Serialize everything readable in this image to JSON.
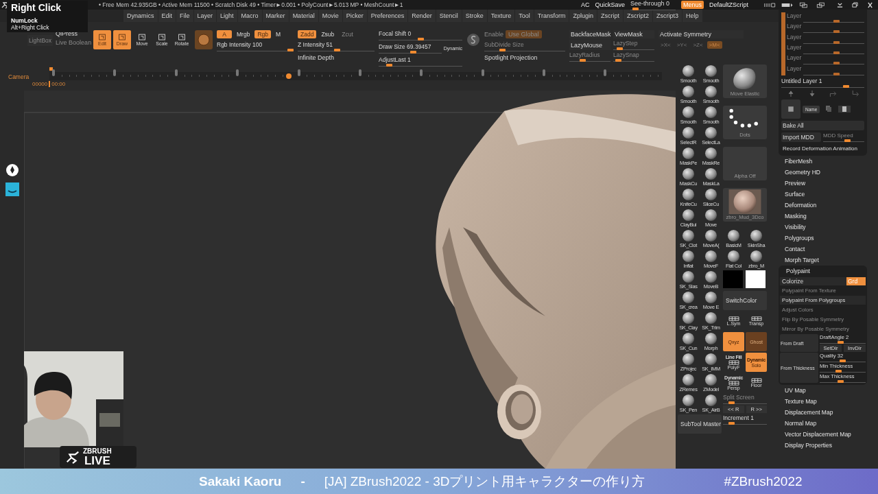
{
  "tooltip": {
    "title": "Right Click",
    "lines": [
      "NumLock",
      "Alt+Right Click"
    ]
  },
  "status_bar": {
    "info": "• Free Mem 42.935GB • Active Mem 11500 • Scratch Disk 49 •  Timer►0.001 • PolyCount►5.013 MP  • MeshCount►1",
    "items": [
      "AC",
      "QuickSave"
    ],
    "see_through": {
      "label": "See-through  0",
      "level": 0.05
    },
    "menus": {
      "label": "Menus",
      "on": true
    },
    "script": "DefaultZScript"
  },
  "menu": [
    "Dynamics",
    "Edit",
    "File",
    "Layer",
    "Light",
    "Macro",
    "Marker",
    "Material",
    "Movie",
    "Picker",
    "Preferences",
    "Render",
    "Stencil",
    "Stroke",
    "Texture",
    "Tool",
    "Transform",
    "Zplugin",
    "Zscript",
    "Zscript2",
    "Zscript3",
    "Help"
  ],
  "shelf": {
    "lightbox": {
      "label": "LightBox",
      "disabled": true
    },
    "live_boolean": {
      "label": "Live Boolean",
      "disabled": true
    },
    "qipress": "QiPress",
    "modes": [
      {
        "label": "Edit",
        "selected": true
      },
      {
        "label": "Draw",
        "selected": true
      },
      {
        "label": "Move",
        "selected": false
      },
      {
        "label": "Scale",
        "selected": false
      },
      {
        "label": "Rotate",
        "selected": false
      }
    ],
    "color_toggles": [
      {
        "label": "A",
        "on": true
      },
      {
        "label": "Mrgb",
        "on": false
      },
      {
        "label": "Rgb",
        "on": true
      },
      {
        "label": "M",
        "on": false
      }
    ],
    "rgb_intensity": {
      "label": "Rgb Intensity 100",
      "level": 1.0
    },
    "z_toggles": [
      {
        "label": "Zadd",
        "on": true,
        "disabled": false
      },
      {
        "label": "Zsub",
        "on": false,
        "disabled": false
      },
      {
        "label": "Zcut",
        "on": false,
        "disabled": true
      }
    ],
    "z_intensity": {
      "label": "Z Intensity 51",
      "level": 0.51
    },
    "infinite_depth": "Infinite Depth",
    "focal_shift": {
      "label": "Focal Shift 0",
      "level": 0.5
    },
    "draw_size": {
      "label": "Draw Size 69.39457",
      "level": 0.55
    },
    "dynamic": "Dynamic",
    "adjust_last": {
      "label": "AdjustLast 1",
      "level": 0.1
    },
    "enable": {
      "label": "Enable",
      "disabled": true
    },
    "use_global": {
      "label": "Use Global",
      "disabled": true
    },
    "subdivide": {
      "label": "SubDivide Size",
      "level": 0.2,
      "disabled": true
    },
    "spotlight": "Spotlight Projection",
    "backface_mask": "BackfaceMask",
    "view_mask": "ViewMask",
    "lazy_mouse": "LazyMouse",
    "lazy_step": {
      "label": "LazyStep",
      "level": 0.1,
      "disabled": true
    },
    "lazy_radius": {
      "label": "LazyRadius",
      "level": 0.3,
      "disabled": true
    },
    "lazy_snap": {
      "label": "LazySnap",
      "level": 0.05,
      "disabled": true
    },
    "activate_symmetry": "Activate Symmetry",
    "axes": [
      {
        "label": ">X<",
        "on": false
      },
      {
        "label": ">Y<",
        "on": false
      },
      {
        "label": ">Z<",
        "on": false
      },
      {
        "label": ">M<",
        "on": true
      }
    ]
  },
  "timeline": {
    "label": "Camera",
    "frame": "00000",
    "time": "00:00",
    "level": 0.39
  },
  "banner": {
    "name": "Sakaki Kaoru",
    "separator": "-",
    "title": "[JA] ZBrush2022 - 3Dプリント用キャラクターの作り方",
    "hashtag": "#ZBrush2022"
  },
  "logo": {
    "top": "ZBRUSH",
    "bottom": "LIVE"
  },
  "brush_palette": [
    {
      "kind": "brush",
      "label": "Smooth"
    },
    {
      "kind": "brush",
      "label": "Smooth"
    },
    {
      "kind": "brush_large",
      "label": "Move Elastic"
    },
    {
      "kind": "brush",
      "label": "Smooth"
    },
    {
      "kind": "brush",
      "label": "Smooth"
    },
    {
      "kind": "brush",
      "label": "Smooth"
    },
    {
      "kind": "brush",
      "label": "Smooth"
    },
    {
      "kind": "stroke",
      "label": "Dots"
    },
    {
      "kind": "brush",
      "label": "SelectR"
    },
    {
      "kind": "brush",
      "label": "SelectLa"
    },
    {
      "kind": "brush",
      "label": "MaskPe"
    },
    {
      "kind": "brush",
      "label": "MaskRe"
    },
    {
      "kind": "alpha",
      "label": "Alpha Off"
    },
    {
      "kind": "brush",
      "label": "MaskCu"
    },
    {
      "kind": "brush",
      "label": "MaskLa"
    },
    {
      "kind": "brush",
      "label": "KnifeCu"
    },
    {
      "kind": "brush",
      "label": "SliceCu"
    },
    {
      "kind": "material",
      "label": "zbro_Mud_3Dco"
    },
    {
      "kind": "brush",
      "label": "ClayBui"
    },
    {
      "kind": "brush",
      "label": "Move"
    },
    {
      "kind": "brush",
      "label": "SK_Clot"
    },
    {
      "kind": "brush",
      "label": "MoveA("
    },
    {
      "kind": "brush",
      "label": "BasicM"
    },
    {
      "kind": "brush",
      "label": "SkinSha"
    },
    {
      "kind": "brush",
      "label": "Inflat"
    },
    {
      "kind": "brush",
      "label": "MoveF"
    },
    {
      "kind": "brush",
      "label": "Flat Col"
    },
    {
      "kind": "brush",
      "label": "zbro_M"
    },
    {
      "kind": "brush",
      "label": "SK_Slas"
    },
    {
      "kind": "brush",
      "label": "MoveB"
    },
    {
      "kind": "swatch",
      "color": "#000000"
    },
    {
      "kind": "swatch",
      "color": "#ffffff"
    },
    {
      "kind": "brush",
      "label": "SK_crea"
    },
    {
      "kind": "brush",
      "label": "Move E"
    },
    {
      "kind": "wide",
      "label": "SwitchColor"
    },
    {
      "kind": "brush",
      "label": "SK_Clay"
    },
    {
      "kind": "brush",
      "label": "SK_Trim"
    },
    {
      "kind": "tool",
      "label": "L.Sym"
    },
    {
      "kind": "tool",
      "label": "Transp"
    },
    {
      "kind": "brush",
      "label": "SK_Cun"
    },
    {
      "kind": "brush",
      "label": "Morph"
    },
    {
      "kind": "toggle",
      "label": "Qxyz",
      "selected": true
    },
    {
      "kind": "toggle",
      "label": "Ghost",
      "selected": false
    },
    {
      "kind": "brush",
      "label": "ZProjec"
    },
    {
      "kind": "brush",
      "label": "SK_IMM"
    },
    {
      "kind": "tool",
      "label": "PolyF",
      "sub": "Line Fill"
    },
    {
      "kind": "toggle",
      "label": "Solo",
      "sub": "Dynamic",
      "selected": true
    },
    {
      "kind": "brush",
      "label": "ZRemes"
    },
    {
      "kind": "brush",
      "label": "ZModel"
    },
    {
      "kind": "tool",
      "label": "Persp",
      "sub": "Dynamic"
    },
    {
      "kind": "tool",
      "label": "Floor"
    },
    {
      "kind": "brush",
      "label": "SK_Pen"
    },
    {
      "kind": "brush",
      "label": "SK_AirB"
    },
    {
      "kind": "split",
      "label": "Split Screen",
      "level": 0.15,
      "buttons": [
        "<< R",
        "R >>"
      ]
    },
    {
      "kind": "wide",
      "label": "SubTool Master"
    },
    {
      "kind": "slider",
      "label": "Increment 1",
      "level": 0.15
    }
  ],
  "layers": {
    "items": [
      {
        "label": "Layer",
        "level": 0.55
      },
      {
        "label": "Layer",
        "level": 0.55
      },
      {
        "label": "Layer",
        "level": 0.55
      },
      {
        "label": "Layer",
        "level": 0.55
      },
      {
        "label": "Layer",
        "level": 0.55
      },
      {
        "label": "Layer",
        "level": 0.55
      }
    ],
    "current": {
      "label": "Untitled Layer 1",
      "level": 0.8
    },
    "name_button": "Name",
    "bake_all": "Bake All",
    "import_mdd": "Import MDD",
    "mdd_speed": {
      "label": "MDD Speed",
      "level": 0.6,
      "disabled": true
    },
    "record": "Record Deformation Animation"
  },
  "subpalettes": [
    {
      "label": "FiberMesh",
      "expanded": false
    },
    {
      "label": "Geometry HD",
      "expanded": false
    },
    {
      "label": "Preview",
      "expanded": false
    },
    {
      "label": "Surface",
      "expanded": false
    },
    {
      "label": "Deformation",
      "expanded": false
    },
    {
      "label": "Masking",
      "expanded": false
    },
    {
      "label": "Visibility",
      "expanded": false
    },
    {
      "label": "Polygroups",
      "expanded": false
    },
    {
      "label": "Contact",
      "expanded": false
    },
    {
      "label": "Morph Target",
      "expanded": false
    },
    {
      "label": "Polypaint",
      "expanded": true
    },
    {
      "label": "UV Map",
      "expanded": false
    },
    {
      "label": "Texture Map",
      "expanded": false
    },
    {
      "label": "Displacement Map",
      "expanded": false
    },
    {
      "label": "Normal Map",
      "expanded": false
    },
    {
      "label": "Vector Displacement Map",
      "expanded": false
    },
    {
      "label": "Display Properties",
      "expanded": false
    }
  ],
  "polypaint": {
    "colorize": "Colorize",
    "grd": {
      "label": "Grd",
      "on": true
    },
    "buttons": [
      {
        "label": "Polypaint From Texture",
        "disabled": true
      },
      {
        "label": "Polypaint From Polygroups",
        "disabled": false
      },
      {
        "label": "Adjust Colors",
        "disabled": true
      },
      {
        "label": "Flip By Posable Symmetry",
        "disabled": true
      },
      {
        "label": "Mirror By Posable Symmetry",
        "disabled": true
      }
    ],
    "from_draft": {
      "label": "From Draft",
      "angle": {
        "label": "DraftAngle  2",
        "level": 0.45
      },
      "buttons": [
        "SetDir",
        "InvDir"
      ]
    },
    "from_thickness": {
      "label": "From Thickness",
      "sliders": [
        {
          "label": "Quality 32",
          "level": 0.5
        },
        {
          "label": "Min Thickness",
          "level": 0.4
        },
        {
          "label": "Max Thickness",
          "level": 0.45
        }
      ]
    }
  }
}
